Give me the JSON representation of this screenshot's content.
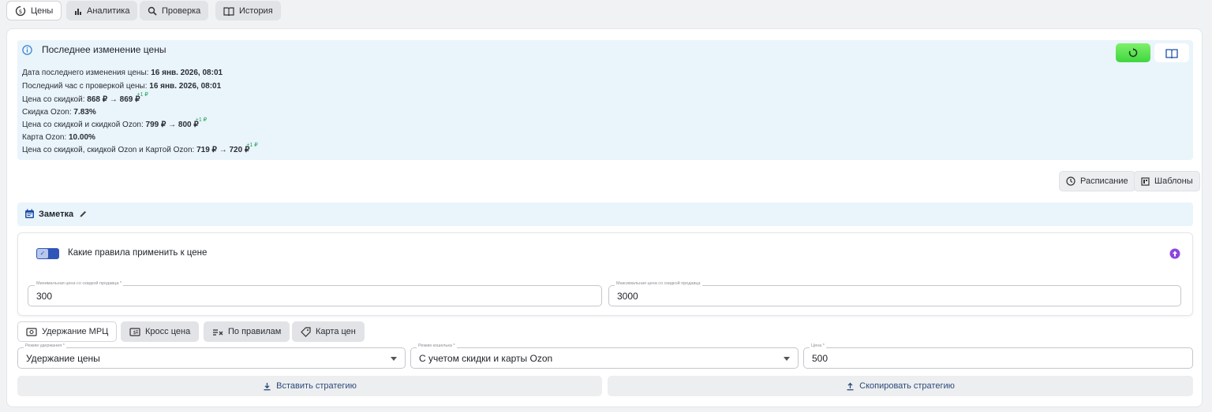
{
  "tabs": [
    {
      "label": "Цены",
      "icon": "price-cycle-icon",
      "active": true
    },
    {
      "label": "Аналитика",
      "icon": "bar-chart-icon",
      "active": false
    },
    {
      "label": "Проверка",
      "icon": "search-icon",
      "active": false
    },
    {
      "label": "История",
      "icon": "book-icon",
      "active": false
    }
  ],
  "info": {
    "title": "Последнее изменение цены",
    "rows": [
      {
        "label": "Дата последнего изменения цены: ",
        "value": "16 янв. 2026, 08:01"
      },
      {
        "label": "Последний час с проверкой цены: ",
        "value": "16 янв. 2026, 08:01"
      },
      {
        "label": "Цена со скидкой: ",
        "value": "868 ₽ → 869 ₽",
        "delta": "+1 ₽"
      },
      {
        "label": "Скидка Ozon: ",
        "value": "7.83%"
      },
      {
        "label": "Цена со скидкой и скидкой Ozon: ",
        "value": "799 ₽ → 800 ₽",
        "delta": "+1 ₽"
      },
      {
        "label": "Карта Ozon: ",
        "value": "10.00%"
      },
      {
        "label": "Цена со скидкой, скидкой Ozon и Картой Ozon: ",
        "value": "719 ₽ → 720 ₽",
        "delta": "+1 ₽"
      }
    ]
  },
  "actions": {
    "schedule": "Расписание",
    "templates": "Шаблоны"
  },
  "note": {
    "label": "Заметка"
  },
  "rules": {
    "title": "Какие правила применить к цене",
    "toggle_on": true,
    "min_label": "Минимальная цена со скидкой продавца *",
    "min_value": "300",
    "max_label": "Максимальная цена со скидкой продавца",
    "max_value": "3000"
  },
  "strategies": [
    {
      "label": "Удержание МРЦ",
      "icon": "money-icon",
      "active": true
    },
    {
      "label": "Кросс цена",
      "icon": "price-tag-icon",
      "active": false
    },
    {
      "label": "По правилам",
      "icon": "rules-icon",
      "active": false
    },
    {
      "label": "Карта цен",
      "icon": "label-icon",
      "active": false
    }
  ],
  "form": {
    "mode_label": "Режим удержания *",
    "mode_value": "Удержание цены",
    "wallet_label": "Режим кошелька *",
    "wallet_value": "С учетом скидки и карты Ozon",
    "price_label": "Цена *",
    "price_value": "500"
  },
  "buttons": {
    "paste": "Вставить стратегию",
    "copy": "Скопировать стратегию"
  },
  "colors": {
    "accent": "#1e4fa8",
    "info_bg": "#eaf4fb",
    "green": "#3fd63f",
    "purple": "#8e44e0"
  }
}
